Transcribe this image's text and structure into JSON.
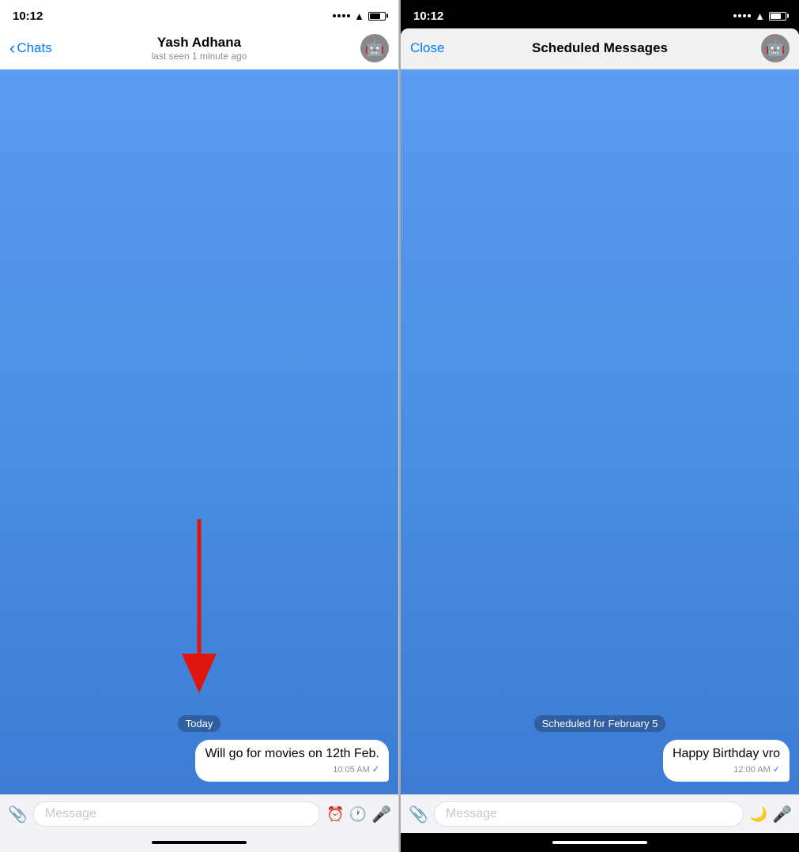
{
  "left_phone": {
    "status_bar": {
      "time": "10:12"
    },
    "nav": {
      "back_label": "Chats",
      "title": "Yash Adhana",
      "subtitle": "last seen 1 minute ago"
    },
    "chat": {
      "date_badge": "Today",
      "message_text": "Will go for movies on 12th Feb.",
      "message_time": "10:05 AM",
      "message_check": "✓"
    },
    "input": {
      "placeholder": "Message"
    }
  },
  "right_phone": {
    "status_bar": {
      "time": "10:12"
    },
    "nav": {
      "close_label": "Close",
      "title": "Scheduled Messages"
    },
    "chat": {
      "scheduled_badge": "Scheduled for February 5",
      "message_text": "Happy Birthday vro",
      "message_time": "12:00 AM",
      "message_check": "✓"
    },
    "input": {
      "placeholder": "Message"
    }
  }
}
